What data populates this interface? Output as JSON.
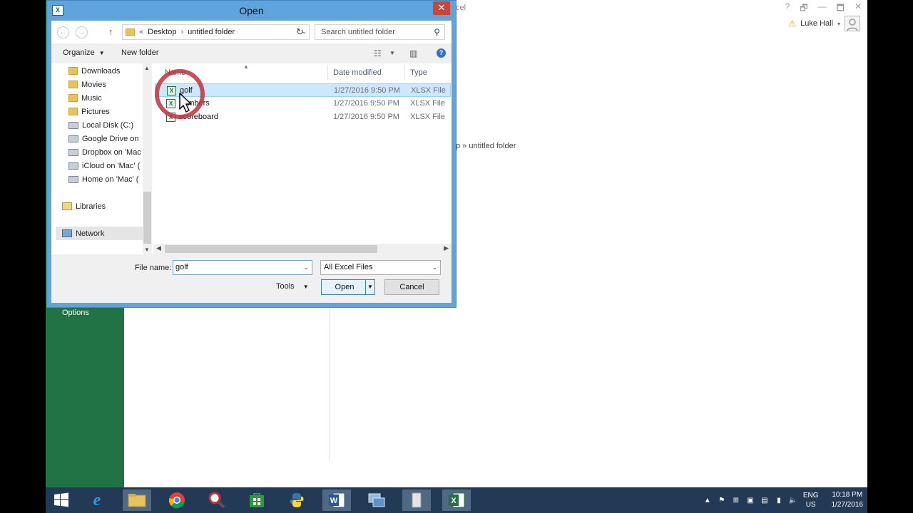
{
  "background": {
    "title_fragment": "cel",
    "path_text": "p » untitled folder",
    "sidebar_options": "Options",
    "user_name": "Luke Hall",
    "window_controls": [
      "?",
      "🗗",
      "—",
      "🗖",
      "✕"
    ]
  },
  "dialog": {
    "title": "Open",
    "close": "✕",
    "address": {
      "chevrons": "«",
      "crumbs": [
        "Desktop",
        "untitled folder"
      ],
      "search_placeholder": "Search untitled folder"
    },
    "toolbar": {
      "organize": "Organize",
      "new_folder": "New folder"
    },
    "nav_items": [
      {
        "label": "Downloads",
        "icon": "folder-icon"
      },
      {
        "label": "Movies",
        "icon": "folder-icon"
      },
      {
        "label": "Music",
        "icon": "folder-icon"
      },
      {
        "label": "Pictures",
        "icon": "folder-icon"
      },
      {
        "label": "Local Disk (C:)",
        "icon": "drive-icon"
      },
      {
        "label": "Google Drive on",
        "icon": "network-drive-icon"
      },
      {
        "label": "Dropbox on 'Mac",
        "icon": "network-drive-icon"
      },
      {
        "label": "iCloud on 'Mac' (",
        "icon": "network-drive-icon"
      },
      {
        "label": "Home on 'Mac' (",
        "icon": "network-drive-icon"
      },
      {
        "label": "Libraries",
        "icon": "library-icon"
      },
      {
        "label": "Network",
        "icon": "network-icon"
      }
    ],
    "columns": {
      "name": "Name",
      "date": "Date modified",
      "type": "Type"
    },
    "files": [
      {
        "name": "golf",
        "date": "1/27/2016 9:50 PM",
        "type": "XLSX File",
        "selected": true
      },
      {
        "name": "numbers",
        "date": "1/27/2016 9:50 PM",
        "type": "XLSX File",
        "selected": false
      },
      {
        "name": "scoreboard",
        "date": "1/27/2016 9:50 PM",
        "type": "XLSX File",
        "selected": false
      }
    ],
    "file_name_label": "File name:",
    "file_name_value": "golf",
    "file_type_value": "All Excel Files",
    "tools_label": "Tools",
    "open_label": "Open",
    "cancel_label": "Cancel"
  },
  "taskbar": {
    "apps": [
      "start",
      "internet-explorer",
      "file-explorer",
      "chrome",
      "magnifier",
      "store",
      "python",
      "word",
      "remote-desktop",
      "unknown-app",
      "excel"
    ],
    "language": [
      "ENG",
      "US"
    ],
    "time": "10:18 PM",
    "date": "1/27/2016"
  },
  "colors": {
    "excel_green": "#217346",
    "dialog_frame": "#5fa4dc",
    "selection": "#cce8ff",
    "taskbar": "#223a56"
  }
}
